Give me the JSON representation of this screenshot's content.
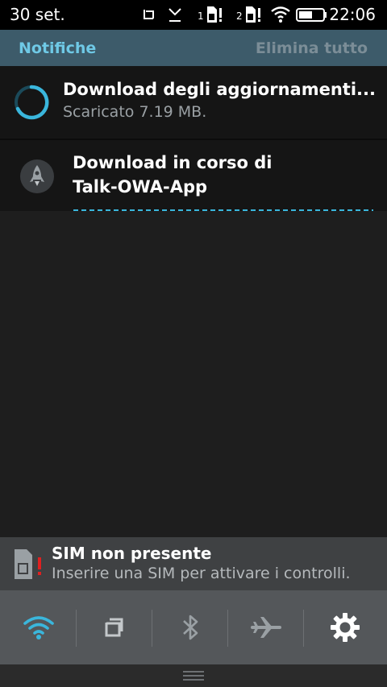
{
  "status_bar": {
    "date": "30 set.",
    "time": "22:06",
    "sim1_label": "1",
    "sim2_label": "2"
  },
  "header": {
    "title": "Notifiche",
    "clear_all": "Elimina tutto"
  },
  "notifications": [
    {
      "title": "Download degli aggiornamenti...",
      "subtitle": "Scaricato 7.19 MB.",
      "icon": "spinner-icon"
    },
    {
      "title_line1": "Download in corso di",
      "title_line2": "Talk-OWA-App",
      "icon": "rocket-icon"
    }
  ],
  "sim_warning": {
    "title": "SIM non presente",
    "subtitle": "Inserire una SIM per attivare i controlli.",
    "icon": "sim-alert-icon"
  },
  "quick_settings": [
    {
      "name": "wifi",
      "icon": "wifi-icon",
      "active": true
    },
    {
      "name": "data",
      "icon": "data-icon",
      "active": false
    },
    {
      "name": "bluetooth",
      "icon": "bluetooth-icon",
      "active": false
    },
    {
      "name": "airplane",
      "icon": "airplane-icon",
      "active": false
    },
    {
      "name": "settings",
      "icon": "gear-icon",
      "active": false
    }
  ],
  "colors": {
    "accent": "#3ab6dc",
    "header_bg": "#3d5b6a",
    "header_title": "#6fc9e6"
  }
}
